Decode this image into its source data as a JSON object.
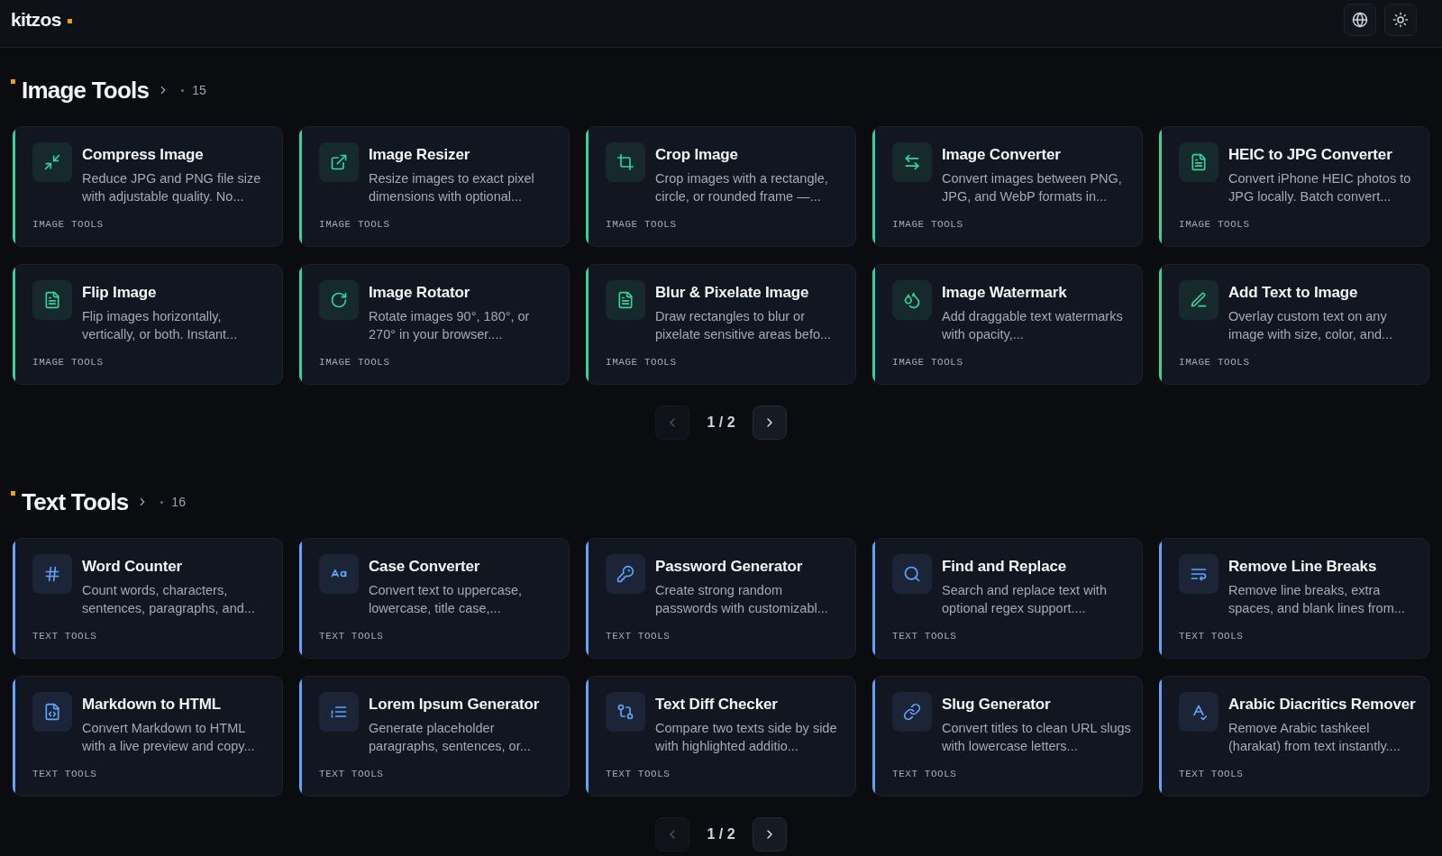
{
  "header": {
    "logo": "kitzos"
  },
  "sections": [
    {
      "title": "Image Tools",
      "count": "15",
      "color": "#34d399",
      "tools": [
        {
          "name": "Compress Image",
          "description": "Reduce JPG and PNG file size with adjustable quality. No...",
          "category": "IMAGE TOOLS"
        },
        {
          "name": "Image Resizer",
          "description": "Resize images to exact pixel dimensions with optional...",
          "category": "IMAGE TOOLS"
        },
        {
          "name": "Crop Image",
          "description": "Crop images with a rectangle, circle, or rounded frame —...",
          "category": "IMAGE TOOLS"
        },
        {
          "name": "Image Converter",
          "description": "Convert images between PNG, JPG, and WebP formats in...",
          "category": "IMAGE TOOLS"
        },
        {
          "name": "HEIC to JPG Converter",
          "description": "Convert iPhone HEIC photos to JPG locally. Batch convert...",
          "category": "IMAGE TOOLS"
        },
        {
          "name": "Flip Image",
          "description": "Flip images horizontally, vertically, or both. Instant...",
          "category": "IMAGE TOOLS"
        },
        {
          "name": "Image Rotator",
          "description": "Rotate images 90°, 180°, or 270° in your browser....",
          "category": "IMAGE TOOLS"
        },
        {
          "name": "Blur & Pixelate Image",
          "description": "Draw rectangles to blur or pixelate sensitive areas befo...",
          "category": "IMAGE TOOLS"
        },
        {
          "name": "Image Watermark",
          "description": "Add draggable text watermarks with opacity,...",
          "category": "IMAGE TOOLS"
        },
        {
          "name": "Add Text to Image",
          "description": "Overlay custom text on any image with size, color, and...",
          "category": "IMAGE TOOLS"
        }
      ],
      "pagination": {
        "page": "1 / 2",
        "previous": {
          "disabled": true
        },
        "next": {
          "disabled": false
        }
      }
    },
    {
      "title": "Text Tools",
      "count": "16",
      "color": "#60a5fa",
      "tools": [
        {
          "name": "Word Counter",
          "description": "Count words, characters, sentences, paragraphs, and...",
          "category": "TEXT TOOLS"
        },
        {
          "name": "Case Converter",
          "description": "Convert text to uppercase, lowercase, title case,...",
          "category": "TEXT TOOLS"
        },
        {
          "name": "Password Generator",
          "description": "Create strong random passwords with customizabl...",
          "category": "TEXT TOOLS"
        },
        {
          "name": "Find and Replace",
          "description": "Search and replace text with optional regex support....",
          "category": "TEXT TOOLS"
        },
        {
          "name": "Remove Line Breaks",
          "description": "Remove line breaks, extra spaces, and blank lines from...",
          "category": "TEXT TOOLS"
        },
        {
          "name": "Markdown to HTML",
          "description": "Convert Markdown to HTML with a live preview and copy...",
          "category": "TEXT TOOLS"
        },
        {
          "name": "Lorem Ipsum Generator",
          "description": "Generate placeholder paragraphs, sentences, or...",
          "category": "TEXT TOOLS"
        },
        {
          "name": "Text Diff Checker",
          "description": "Compare two texts side by side with highlighted additio...",
          "category": "TEXT TOOLS"
        },
        {
          "name": "Slug Generator",
          "description": "Convert titles to clean URL slugs with lowercase letters...",
          "category": "TEXT TOOLS"
        },
        {
          "name": "Arabic Diacritics Remover",
          "description": "Remove Arabic tashkeel (harakat) from text instantly....",
          "category": "TEXT TOOLS"
        }
      ],
      "pagination": {
        "page": "1 / 2",
        "previous": {
          "disabled": true
        },
        "next": {
          "disabled": false
        }
      }
    }
  ]
}
